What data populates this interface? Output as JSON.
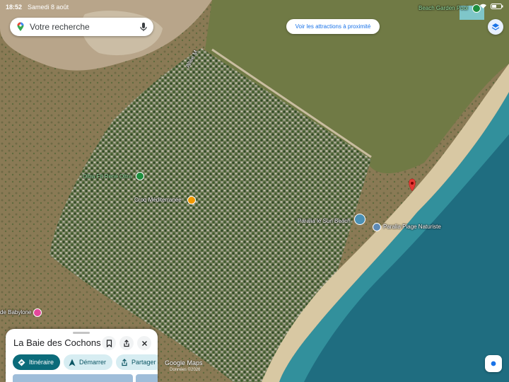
{
  "status_bar": {
    "time": "18:52",
    "date": "Samedi 8 août",
    "battery": ""
  },
  "search": {
    "placeholder": "Votre recherche"
  },
  "nearby_chip": {
    "label": "Voir les attractions à proximité"
  },
  "map_labels": {
    "beach_garden": "Beach Garden Pool",
    "alle_m": "Allée M",
    "oltra_fit": "Oltra Fit René Oltra",
    "croq": "Croq Méditerranée",
    "paralia_sun": "Paralia le Sun Beach",
    "paralia_plage": "Paralia Plage Naturiste",
    "babylone": "de Babylone"
  },
  "place_panel": {
    "title": "La Baie des Cochons",
    "actions": [
      {
        "label": "Itinéraire",
        "icon": "directions-icon"
      },
      {
        "label": "Démarrer",
        "icon": "navigation-arrow-icon"
      },
      {
        "label": "Partager",
        "icon": "share-icon"
      }
    ]
  },
  "attribution": {
    "logo": "Google Maps",
    "copyright": "Données ©2026"
  },
  "colors": {
    "accent": "#1a73e8",
    "primary_action": "#0b6b7a",
    "sea": "#1f6d80",
    "beach": "#d8c8a3",
    "pin": "#e53935"
  }
}
